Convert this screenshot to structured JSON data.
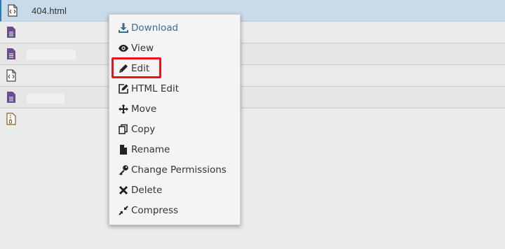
{
  "files": [
    {
      "name": "404.html",
      "icon": "html-file-icon",
      "selected": true
    },
    {
      "name": "",
      "icon": "text-file-icon",
      "selected": false
    },
    {
      "name": "",
      "icon": "text-file-icon",
      "selected": false
    },
    {
      "name": "",
      "icon": "html-file-icon",
      "selected": false
    },
    {
      "name": "",
      "icon": "text-file-icon",
      "selected": false
    },
    {
      "name": "",
      "icon": "zip-file-icon",
      "selected": false
    }
  ],
  "context_menu": {
    "items": [
      {
        "label": "Download",
        "icon": "download-icon"
      },
      {
        "label": "View",
        "icon": "eye-icon"
      },
      {
        "label": "Edit",
        "icon": "pencil-icon"
      },
      {
        "label": "HTML Edit",
        "icon": "edit-square-icon"
      },
      {
        "label": "Move",
        "icon": "move-arrows-icon"
      },
      {
        "label": "Copy",
        "icon": "copy-icon"
      },
      {
        "label": "Rename",
        "icon": "file-icon"
      },
      {
        "label": "Change Permissions",
        "icon": "key-icon"
      },
      {
        "label": "Delete",
        "icon": "x-icon"
      },
      {
        "label": "Compress",
        "icon": "compress-icon"
      }
    ],
    "highlighted_item": "Edit"
  },
  "colors": {
    "selected_row": "#c9dbe8",
    "highlight_border": "#e8151d",
    "download_link": "#3b6d95",
    "purple_file": "#6b4c8f"
  }
}
